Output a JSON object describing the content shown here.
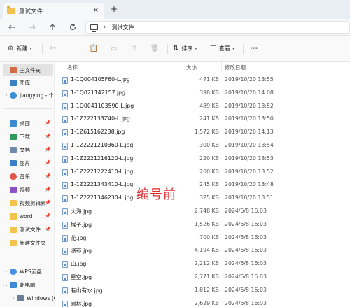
{
  "window": {
    "tab_title": "测试文件",
    "close_glyph": "✕",
    "new_tab_glyph": "+"
  },
  "address": {
    "path": "测试文件"
  },
  "toolbar": {
    "new_label": "新建",
    "sort_label": "排序",
    "view_label": "查看",
    "more_glyph": "···"
  },
  "sidebar": {
    "home": "主文件夹",
    "gallery": "图库",
    "cloud": "jiangying - 个",
    "desktop": "桌面",
    "downloads": "下载",
    "documents": "文档",
    "pictures": "图片",
    "music": "音乐",
    "videos": "视频",
    "video_edit": "视频剪辑素",
    "word": "word",
    "test_files": "测试文件",
    "new_folder": "新建文件夹",
    "wps": "WPS云盘",
    "this_pc": "此电脑",
    "windows": "Windows (C"
  },
  "columns": {
    "name": "名称",
    "size": "大小",
    "modified": "修改日期"
  },
  "files": [
    {
      "name": "1-1Q004105F60-L.jpg",
      "size": "471 KB",
      "date": "2019/10/20 13:55"
    },
    {
      "name": "1-1Q021142157.jpg",
      "size": "398 KB",
      "date": "2019/10/20 14:08"
    },
    {
      "name": "1-1Q0041103590-L.jpg",
      "size": "489 KB",
      "date": "2019/10/20 13:52"
    },
    {
      "name": "1-1Z222133Z40-L.jpg",
      "size": "241 KB",
      "date": "2019/10/20 13:50"
    },
    {
      "name": "1-1Z615162238.jpg",
      "size": "1,572 KB",
      "date": "2019/10/20 14:13"
    },
    {
      "name": "1-1Z2221210360-L.jpg",
      "size": "300 KB",
      "date": "2019/10/20 13:54"
    },
    {
      "name": "1-1Z2221216120-L.jpg",
      "size": "220 KB",
      "date": "2019/10/20 13:53"
    },
    {
      "name": "1-1Z2221222410-L.jpg",
      "size": "200 KB",
      "date": "2019/10/20 13:52"
    },
    {
      "name": "1-1Z2221343410-L.jpg",
      "size": "245 KB",
      "date": "2019/10/20 13:48"
    },
    {
      "name": "1-1Z2221346230-L.jpg",
      "size": "325 KB",
      "date": "2019/10/20 13:51"
    },
    {
      "name": "大海.jpg",
      "size": "2,748 KB",
      "date": "2024/5/8 16:03"
    },
    {
      "name": "猴子.jpg",
      "size": "1,526 KB",
      "date": "2024/5/8 16:03"
    },
    {
      "name": "花.jpg",
      "size": "700 KB",
      "date": "2024/5/8 16:03"
    },
    {
      "name": "瀑布.jpg",
      "size": "4,194 KB",
      "date": "2024/5/8 16:03"
    },
    {
      "name": "山.jpg",
      "size": "2,212 KB",
      "date": "2024/5/8 16:03"
    },
    {
      "name": "星空.jpg",
      "size": "2,771 KB",
      "date": "2024/5/8 16:03"
    },
    {
      "name": "有山有水.jpg",
      "size": "1,812 KB",
      "date": "2024/5/8 16:03"
    },
    {
      "name": "园林.jpg",
      "size": "2,629 KB",
      "date": "2024/5/8 16:03"
    }
  ],
  "annotation": "编号前",
  "colors": {
    "annotation": "#e0262a",
    "folder": "#f2c44f",
    "selection": "#e3e3e3"
  }
}
